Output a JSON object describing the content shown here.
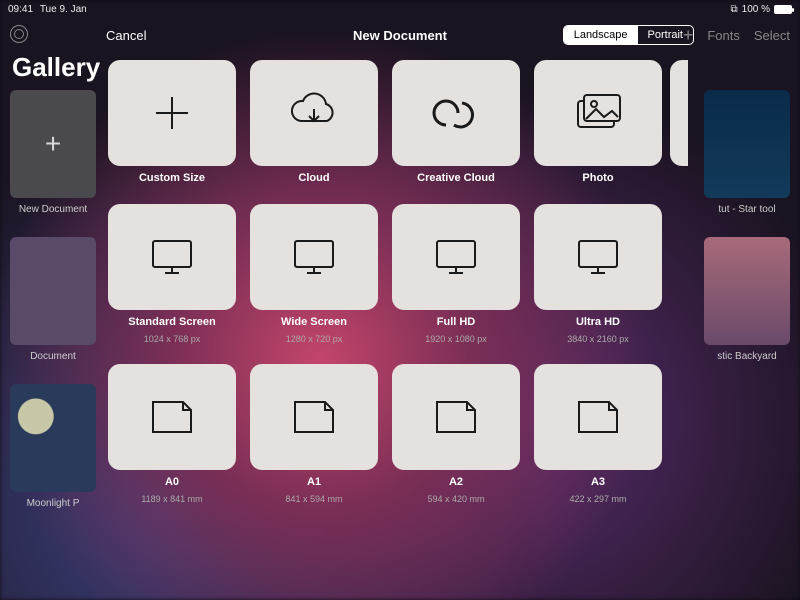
{
  "statusbar": {
    "time": "09:41",
    "date": "Tue 9. Jan",
    "battery": "100 %"
  },
  "toolbar": {
    "plus_label": "+",
    "fonts_label": "Fonts",
    "select_label": "Select"
  },
  "gallery": {
    "title": "Gallery",
    "bg_left": [
      {
        "label": "New Document"
      },
      {
        "label": "Document"
      },
      {
        "label": "Moonlight P"
      }
    ],
    "bg_right": [
      {
        "label": "tut - Star tool"
      },
      {
        "label": "stic Backyard"
      }
    ]
  },
  "modal": {
    "cancel": "Cancel",
    "title": "New Document",
    "orientation": {
      "landscape": "Landscape",
      "portrait": "Portrait",
      "active": "landscape"
    },
    "row1": [
      {
        "icon": "plus",
        "label": "Custom Size"
      },
      {
        "icon": "cloud",
        "label": "Cloud"
      },
      {
        "icon": "cc",
        "label": "Creative Cloud"
      },
      {
        "icon": "photo",
        "label": "Photo"
      }
    ],
    "row2": [
      {
        "icon": "screen",
        "label": "Standard Screen",
        "sub": "1024 x 768 px"
      },
      {
        "icon": "screen",
        "label": "Wide Screen",
        "sub": "1280 x 720 px"
      },
      {
        "icon": "screen",
        "label": "Full HD",
        "sub": "1920 x 1080 px"
      },
      {
        "icon": "screen",
        "label": "Ultra HD",
        "sub": "3840 x 2160 px"
      }
    ],
    "row3": [
      {
        "icon": "page",
        "label": "A0",
        "sub": "1189 x 841 mm"
      },
      {
        "icon": "page",
        "label": "A1",
        "sub": "841 x 594 mm"
      },
      {
        "icon": "page",
        "label": "A2",
        "sub": "594 x 420 mm"
      },
      {
        "icon": "page",
        "label": "A3",
        "sub": "422 x 297 mm"
      }
    ]
  }
}
